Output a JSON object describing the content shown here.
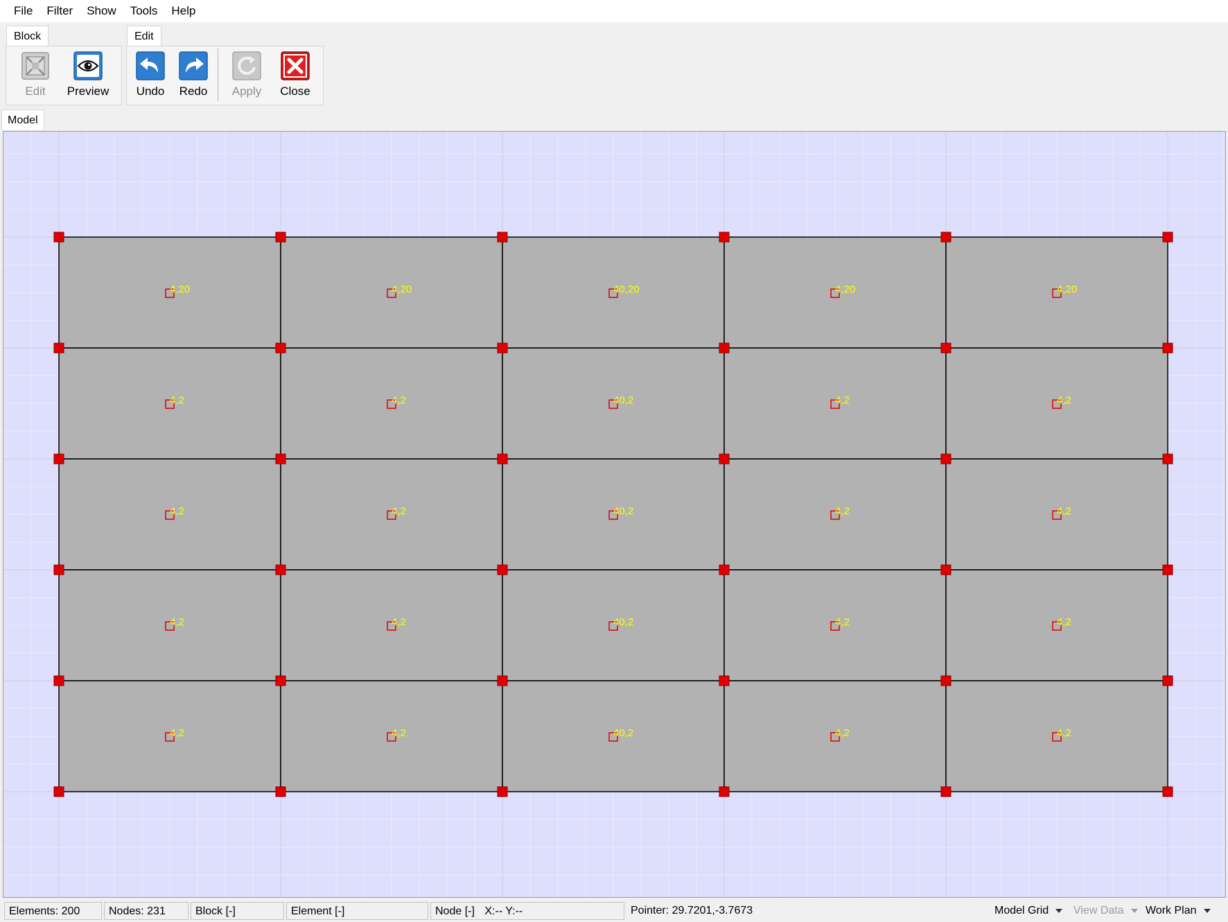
{
  "menu": [
    "File",
    "Filter",
    "Show",
    "Tools",
    "Help"
  ],
  "ribbon": {
    "block_group": {
      "label": "Block",
      "buttons": [
        {
          "label": "Edit",
          "icon": "edit-frame-icon",
          "enabled": false
        },
        {
          "label": "Preview",
          "icon": "eye-icon",
          "enabled": true
        }
      ]
    },
    "edit_group": {
      "label": "Edit",
      "buttons": [
        {
          "label": "Undo",
          "icon": "undo-icon",
          "enabled": true
        },
        {
          "label": "Redo",
          "icon": "redo-icon",
          "enabled": true
        },
        {
          "label": "Apply",
          "icon": "apply-icon",
          "enabled": false
        },
        {
          "label": "Close",
          "icon": "close-icon",
          "enabled": true
        }
      ]
    }
  },
  "view_tab": "Model",
  "model": {
    "columns": 5,
    "rows": 5,
    "element_labels": [
      [
        "4,20",
        "4,20",
        "40,20",
        "4,20",
        "4,20"
      ],
      [
        "4,2",
        "4,2",
        "40,2",
        "4,2",
        "4,2"
      ],
      [
        "4,2",
        "4,2",
        "40,2",
        "4,2",
        "4,2"
      ],
      [
        "4,2",
        "4,2",
        "40,2",
        "4,2",
        "4,2"
      ],
      [
        "4,2",
        "4,2",
        "40,2",
        "4,2",
        "4,2"
      ]
    ],
    "colors": {
      "background": "#dedefd",
      "element_fill": "#b2b2b2",
      "element_edge": "#000000",
      "node": "#e00000",
      "label": "#ffff00",
      "grid_minor": "#ececff",
      "grid_major": "#cfcfe6"
    }
  },
  "status": {
    "elements": "Elements: 200",
    "nodes": "Nodes: 231",
    "block": "Block [-]",
    "element": "Element [-]",
    "node": "Node [-]",
    "xy": "X:--  Y:--",
    "pointer": "Pointer: 29.7201,-3.7673",
    "model_grid": "Model Grid",
    "view_data": "View Data",
    "work_plan": "Work Plan"
  }
}
